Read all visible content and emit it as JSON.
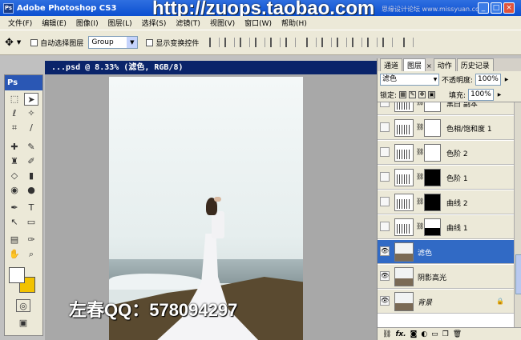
{
  "titlebar": {
    "app_title": "Adobe Photoshop CS3",
    "ps_badge": "Ps",
    "minimize": "_",
    "maximize": "□",
    "close": "×"
  },
  "watermark": {
    "top": "http://zuops.taobao.com",
    "small": "思缘设计论坛 www.missyuan.com",
    "qq": "左春QQ：578094297"
  },
  "menu": [
    {
      "label": "文件(F)"
    },
    {
      "label": "编辑(E)"
    },
    {
      "label": "图像(I)"
    },
    {
      "label": "图层(L)"
    },
    {
      "label": "选择(S)"
    },
    {
      "label": "滤镜(T)"
    },
    {
      "label": "视图(V)"
    },
    {
      "label": "窗口(W)"
    },
    {
      "label": "帮助(H)"
    }
  ],
  "options": {
    "auto_select": "自动选择图层",
    "group": "Group",
    "show_transform": "显示变换控件"
  },
  "toolbox": {
    "logo": "Ps"
  },
  "document": {
    "title": "...psd @ 8.33% (滤色, RGB/8)"
  },
  "panel": {
    "tabs": [
      {
        "label": "通道"
      },
      {
        "label": "图层"
      },
      {
        "label": "动作"
      },
      {
        "label": "历史记录"
      }
    ],
    "blend_mode": "滤色",
    "opacity_label": "不透明度:",
    "opacity": "100%",
    "lock_label": "锁定:",
    "fill_label": "填充:",
    "fill": "100%",
    "layers": [
      {
        "name": "黑白 副本"
      },
      {
        "name": "色相/饱和度 1"
      },
      {
        "name": "色阶 2"
      },
      {
        "name": "色阶 1"
      },
      {
        "name": "曲线 2"
      },
      {
        "name": "曲线 1"
      },
      {
        "name": "滤色"
      },
      {
        "name": "阴影高光"
      },
      {
        "name": "背景"
      }
    ],
    "bottom_icons": [
      "link-icon",
      "fx-icon",
      "mask-icon",
      "adjustment-icon",
      "folder-icon",
      "new-layer-icon",
      "trash-icon"
    ]
  },
  "colors": {
    "title_blue": "#0b4fd0",
    "selection_blue": "#316ac5",
    "foreground": "#ffffff",
    "background": "#f2c200"
  }
}
